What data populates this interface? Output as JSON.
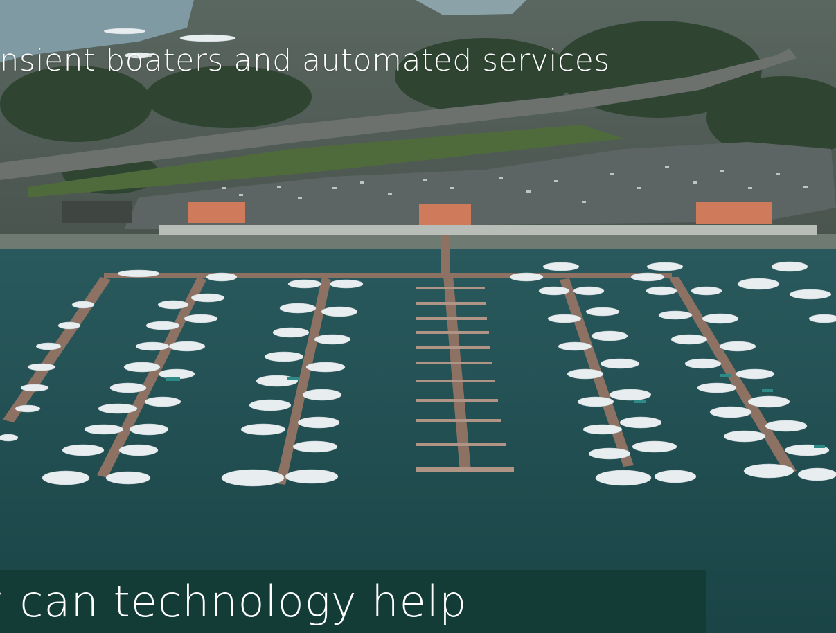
{
  "slide": {
    "subtitle": "ansient boaters and automated services",
    "headline": "w can technology help"
  },
  "photo": {
    "subject": "aerial-marina-photo",
    "colors": {
      "water": "#1e4a4c",
      "land": "#4a5a4a",
      "parking": "#5b6262",
      "trees": "#2f4a2f",
      "dock": "#8a6e60",
      "boat": "#e9eef0",
      "roof": "#d07a5a",
      "banner": "#133c37"
    }
  }
}
